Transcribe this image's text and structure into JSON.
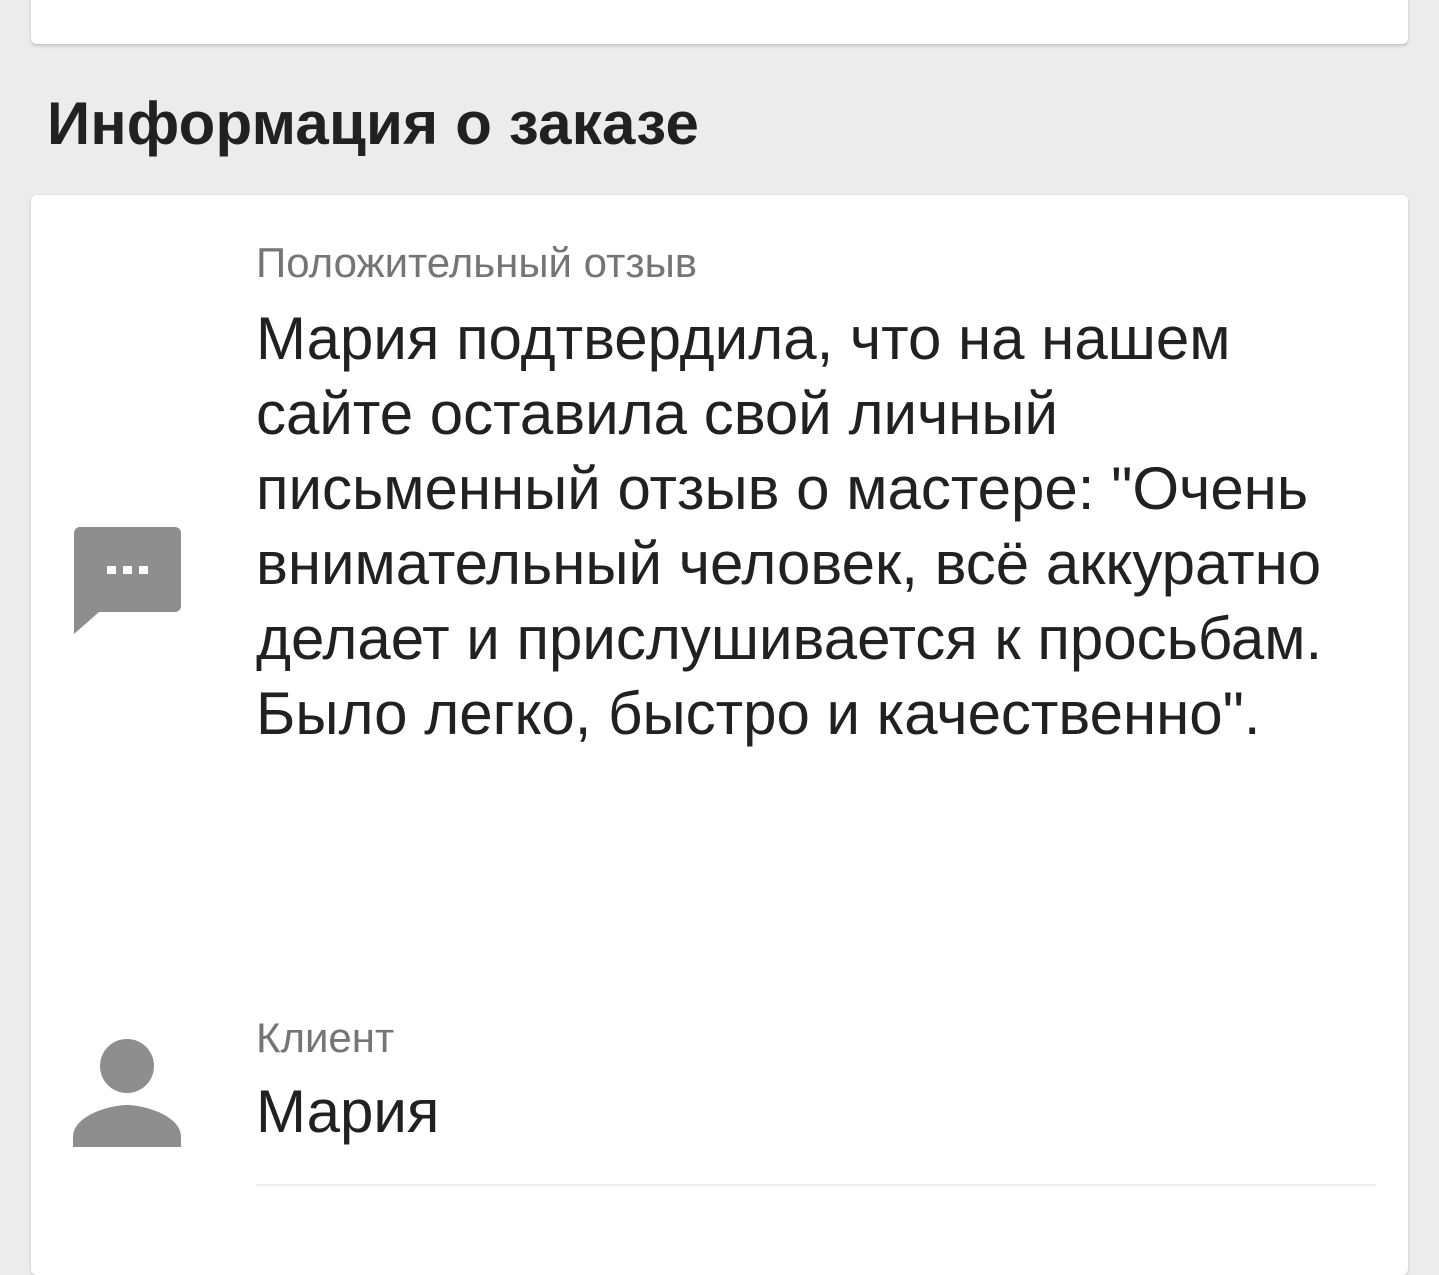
{
  "section": {
    "title": "Информация о заказе"
  },
  "review": {
    "icon": "chat-bubble-icon",
    "label": "Положительный отзыв",
    "text": "Мария подтвердила, что на нашем сайте оставила свой личный письменный отзыв о мастере: \"Очень внимательный человек, всё аккуратно делает и прислушивается к просьбам. Было легко, быстро и качественно\"."
  },
  "client": {
    "icon": "person-icon",
    "label": "Клиент",
    "name": "Мария"
  },
  "colors": {
    "background": "#ececec",
    "card": "#ffffff",
    "title_text": "#212121",
    "label_text": "#757575",
    "icon": "#8e8e8e"
  }
}
